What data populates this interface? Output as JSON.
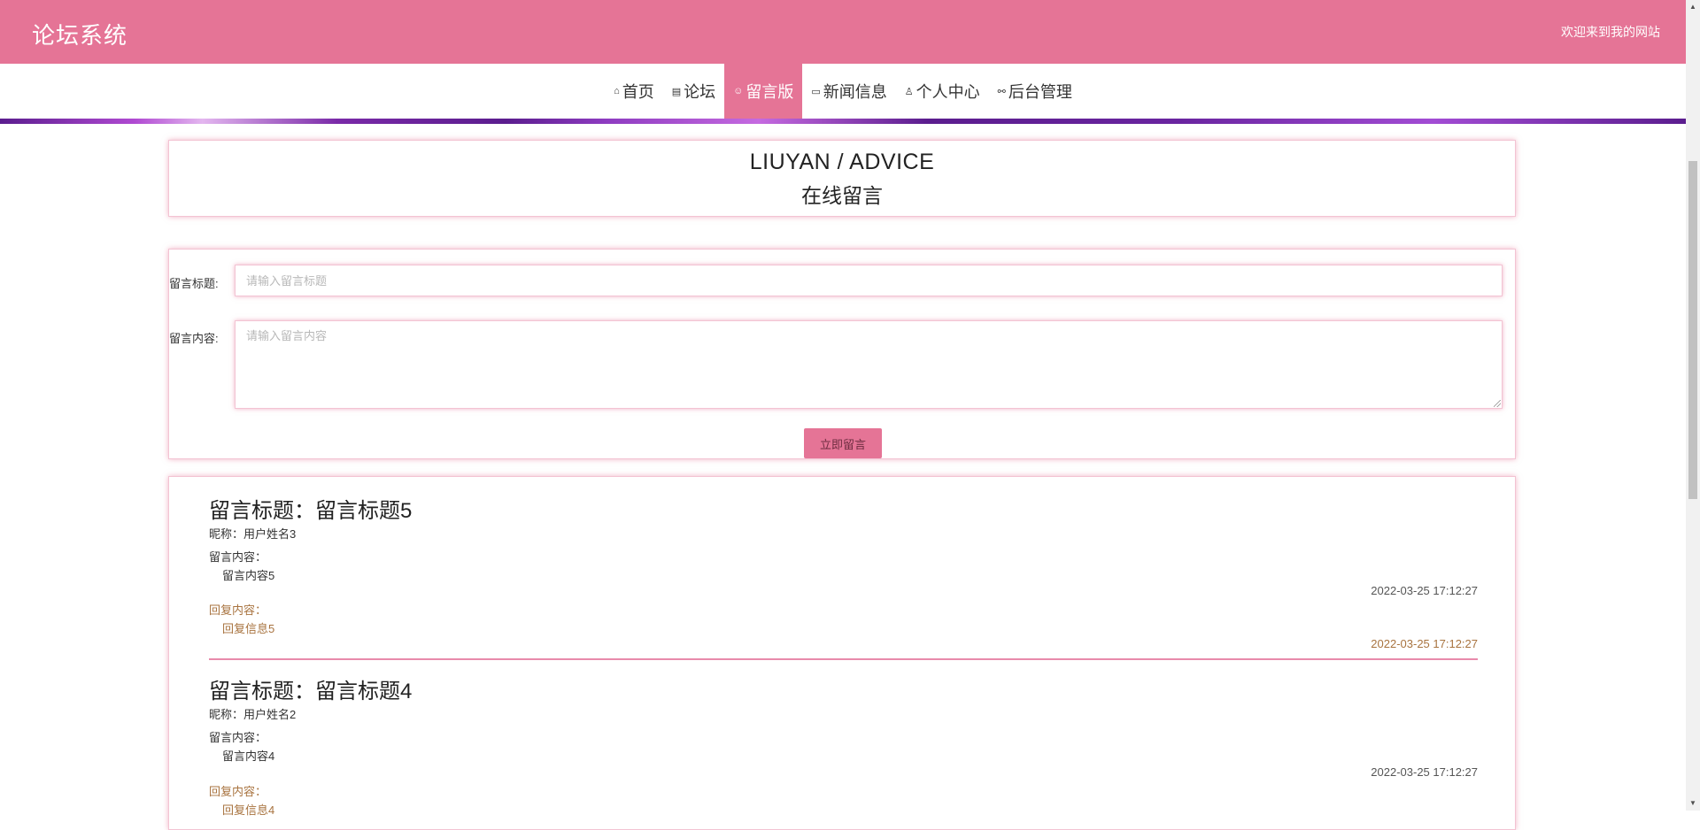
{
  "header": {
    "brand": "论坛系统",
    "welcome": "欢迎来到我的网站"
  },
  "nav": {
    "items": [
      {
        "icon": "⌂",
        "label": "首页"
      },
      {
        "icon": "▤",
        "label": "论坛"
      },
      {
        "icon": "☺",
        "label": "留言版"
      },
      {
        "icon": "▭",
        "label": "新闻信息"
      },
      {
        "icon": "♙",
        "label": "个人中心"
      },
      {
        "icon": "⚯",
        "label": "后台管理"
      }
    ],
    "active": "留言版"
  },
  "title_panel": {
    "en": "LIUYAN / ADVICE",
    "cn": "在线留言"
  },
  "form": {
    "title_label": "留言标题:",
    "title_placeholder": "请输入留言标题",
    "content_label": "留言内容:",
    "content_placeholder": "请输入留言内容",
    "submit_label": "立即留言"
  },
  "messages": [
    {
      "title": "留言标题：留言标题5",
      "nickname": "昵称：用户姓名3",
      "content_label": "留言内容：",
      "content": "留言内容5",
      "time": "2022-03-25 17:12:27",
      "reply_label": "回复内容：",
      "reply": "回复信息5",
      "reply_time": "2022-03-25 17:12:27"
    },
    {
      "title": "留言标题：留言标题4",
      "nickname": "昵称：用户姓名2",
      "content_label": "留言内容：",
      "content": "留言内容4",
      "time": "2022-03-25 17:12:27",
      "reply_label": "回复内容：",
      "reply": "回复信息4",
      "reply_time": ""
    }
  ],
  "colors": {
    "primary": "#e57496",
    "reply_text": "#a8733f",
    "nav_accent_line": "#5b1d8e"
  }
}
